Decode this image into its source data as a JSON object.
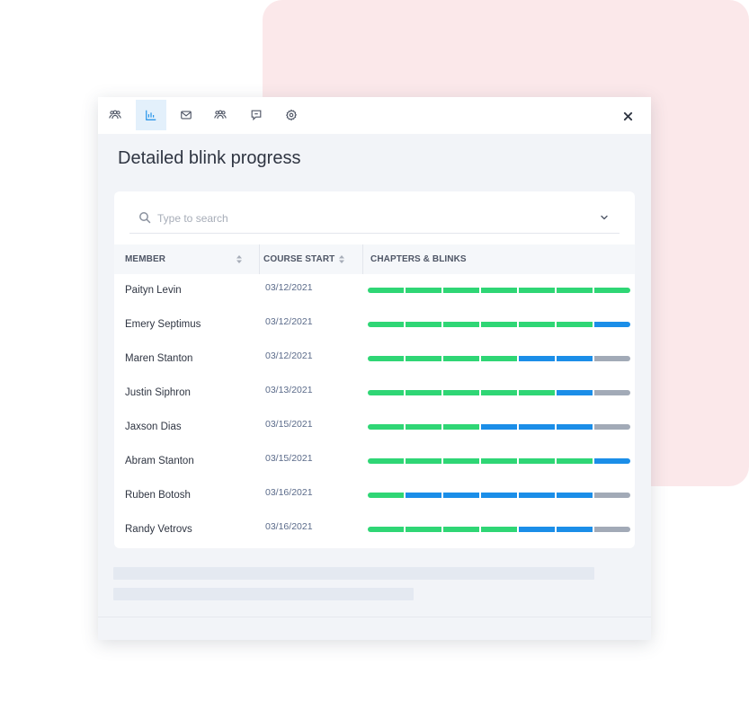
{
  "colors": {
    "complete": "#2fd675",
    "in_progress": "#1b8ee8",
    "not_started": "#a2aab7"
  },
  "toolbar": {
    "items": [
      {
        "icon": "team-icon",
        "active": false
      },
      {
        "icon": "bar-chart-icon",
        "active": true
      },
      {
        "icon": "mail-icon",
        "active": false
      },
      {
        "icon": "group-icon",
        "active": false
      },
      {
        "icon": "comment-icon",
        "active": false
      },
      {
        "icon": "settings-icon",
        "active": false
      }
    ],
    "close_icon": "close-icon"
  },
  "page": {
    "title": "Detailed blink progress"
  },
  "search": {
    "placeholder": "Type to search",
    "value": ""
  },
  "table": {
    "columns": [
      "MEMBER",
      "COURSE START",
      "CHAPTERS & BLINKS"
    ],
    "rows": [
      {
        "member": "Paityn Levin",
        "start": "03/12/2021",
        "progress": [
          "complete",
          "complete",
          "complete",
          "complete",
          "complete",
          "complete",
          "complete"
        ]
      },
      {
        "member": "Emery Septimus",
        "start": "03/12/2021",
        "progress": [
          "complete",
          "complete",
          "complete",
          "complete",
          "complete",
          "complete",
          "in_progress"
        ]
      },
      {
        "member": "Maren Stanton",
        "start": "03/12/2021",
        "progress": [
          "complete",
          "complete",
          "complete",
          "complete",
          "in_progress",
          "in_progress",
          "not_started"
        ]
      },
      {
        "member": "Justin Siphron",
        "start": "03/13/2021",
        "progress": [
          "complete",
          "complete",
          "complete",
          "complete",
          "complete",
          "in_progress",
          "not_started"
        ]
      },
      {
        "member": "Jaxson Dias",
        "start": "03/15/2021",
        "progress": [
          "complete",
          "complete",
          "complete",
          "in_progress",
          "in_progress",
          "in_progress",
          "not_started"
        ]
      },
      {
        "member": "Abram Stanton",
        "start": "03/15/2021",
        "progress": [
          "complete",
          "complete",
          "complete",
          "complete",
          "complete",
          "complete",
          "in_progress"
        ]
      },
      {
        "member": "Ruben Botosh",
        "start": "03/16/2021",
        "progress": [
          "complete",
          "in_progress",
          "in_progress",
          "in_progress",
          "in_progress",
          "in_progress",
          "not_started"
        ]
      },
      {
        "member": "Randy Vetrovs",
        "start": "03/16/2021",
        "progress": [
          "complete",
          "complete",
          "complete",
          "complete",
          "in_progress",
          "in_progress",
          "not_started"
        ]
      }
    ]
  }
}
